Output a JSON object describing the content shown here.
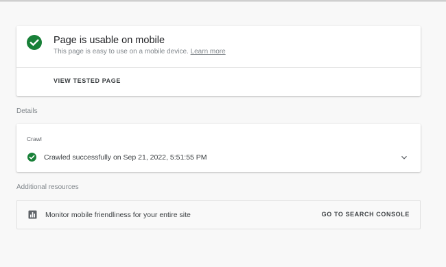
{
  "usability": {
    "title": "Page is usable on mobile",
    "subtitle": "This page is easy to use on a mobile device.",
    "learn_more": "Learn more",
    "view_button": "VIEW TESTED PAGE"
  },
  "details": {
    "section_label": "Details",
    "crawl_label": "Crawl",
    "crawl_status": "Crawled successfully on Sep 21, 2022, 5:51:55 PM"
  },
  "resources": {
    "section_label": "Additional resources",
    "item_text": "Monitor mobile friendliness for your entire site",
    "console_button": "GO TO SEARCH CONSOLE"
  },
  "colors": {
    "success": "#188038",
    "text_primary": "#202124",
    "text_secondary": "#80868b",
    "background": "#f8f8f8"
  },
  "icons": {
    "usable": "check-circle-icon",
    "crawl": "check-circle-icon",
    "expand": "chevron-down-icon",
    "resource": "bar-chart-icon"
  }
}
